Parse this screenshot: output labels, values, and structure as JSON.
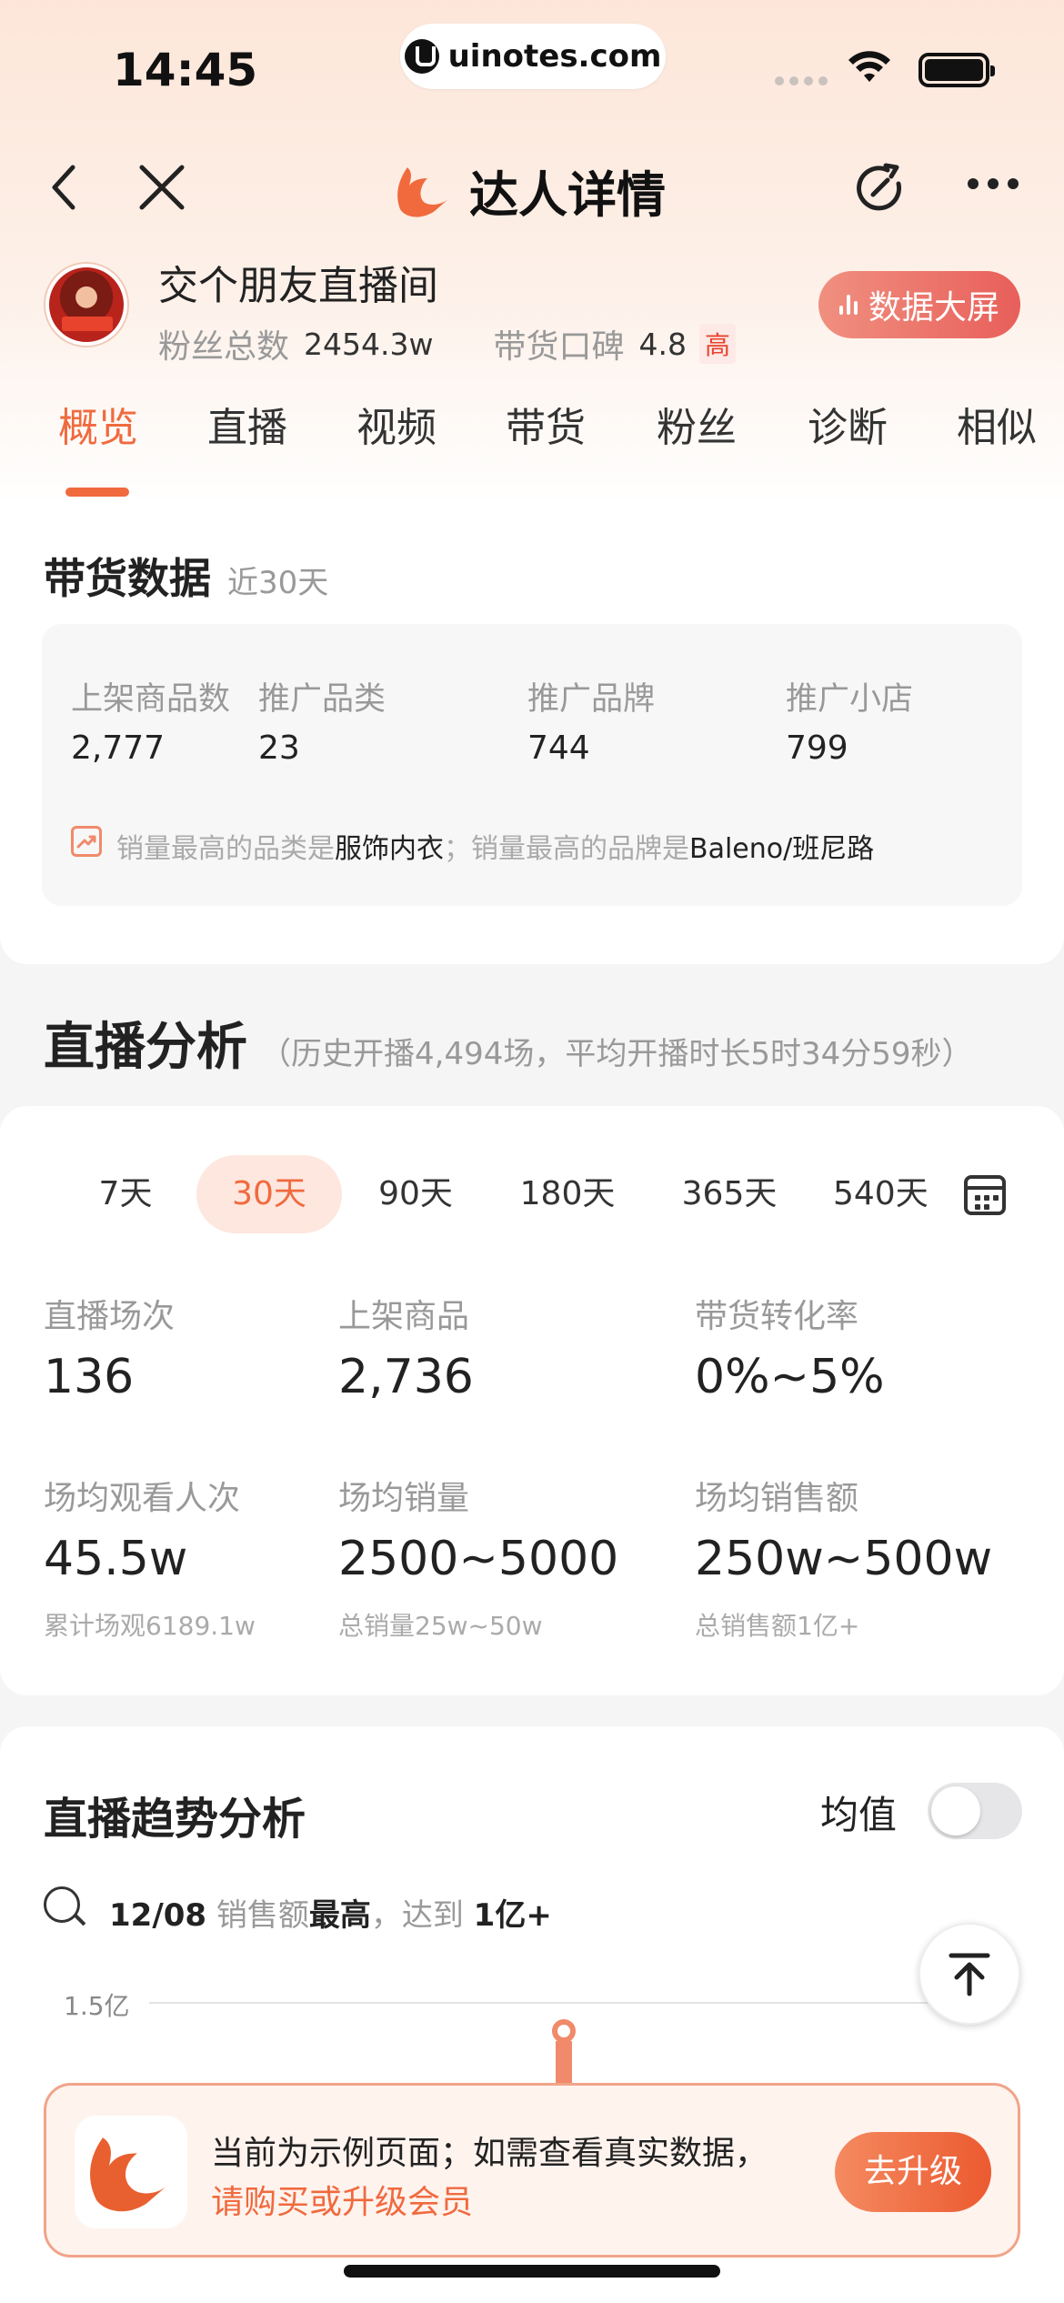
{
  "status_bar": {
    "time": "14:45",
    "url": "uinotes.com"
  },
  "header": {
    "title": "达人详情"
  },
  "profile": {
    "name": "交个朋友直播间",
    "fans_label": "粉丝总数",
    "fans_value": "2454.3w",
    "rep_label": "带货口碑",
    "rep_value": "4.8",
    "rep_level": "高",
    "big_screen_label": "数据大屏"
  },
  "tabs": [
    "概览",
    "直播",
    "视频",
    "带货",
    "粉丝",
    "诊断",
    "相似"
  ],
  "goods": {
    "title": "带货数据",
    "period": "近30天",
    "stats": [
      {
        "label": "上架商品数",
        "value": "2,777"
      },
      {
        "label": "推广品类",
        "value": "23"
      },
      {
        "label": "推广品牌",
        "value": "744"
      },
      {
        "label": "推广小店",
        "value": "799"
      }
    ],
    "tip_prefix": "销量最高的品类是",
    "tip_category": "服饰内衣",
    "tip_mid": "；销量最高的品牌是",
    "tip_brand": "Baleno/班尼路"
  },
  "live": {
    "title": "直播分析",
    "subtitle": "（历史开播4,494场，平均开播时长5时34分59秒）",
    "periods": [
      "7天",
      "30天",
      "90天",
      "180天",
      "365天",
      "540天"
    ],
    "active_period": "30天",
    "metrics": [
      {
        "label": "直播场次",
        "value": "136",
        "sub": ""
      },
      {
        "label": "上架商品",
        "value": "2,736",
        "sub": ""
      },
      {
        "label": "带货转化率",
        "value": "0%~5%",
        "sub": ""
      },
      {
        "label": "场均观看人次",
        "value": "45.5w",
        "sub": "累计场观6189.1w"
      },
      {
        "label": "场均销量",
        "value": "2500~5000",
        "sub": "总销量25w~50w"
      },
      {
        "label": "场均销售额",
        "value": "250w~500w",
        "sub": "总销售额1亿+"
      }
    ]
  },
  "trend": {
    "title": "直播趋势分析",
    "avg_label": "均值",
    "highlight_date": "12/08",
    "highlight_metric": "销售额",
    "highlight_word": "最高",
    "highlight_mid": "，达到",
    "highlight_value": "1亿+",
    "ytick": "1.5亿"
  },
  "banner": {
    "line1": "当前为示例页面；如需查看真实数据，",
    "line2": "请购买或升级会员",
    "button": "去升级"
  },
  "colors": {
    "accent": "#f06a3e",
    "danger": "#e8432c",
    "bg": "#f5f5f6"
  }
}
